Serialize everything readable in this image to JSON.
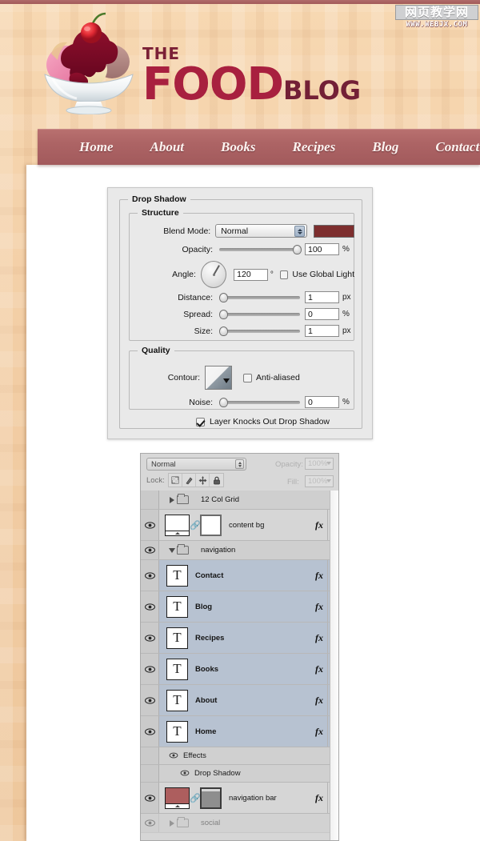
{
  "site": {
    "brand_the": "THE",
    "brand_food": "FOOD",
    "brand_blog": "BLOG",
    "logo_icon": "ice-cream-sundae-icon",
    "nav": [
      {
        "label": "Home"
      },
      {
        "label": "About"
      },
      {
        "label": "Books"
      },
      {
        "label": "Recipes"
      },
      {
        "label": "Blog"
      },
      {
        "label": "Contact"
      }
    ],
    "colors": {
      "nav_bar": "#ad6465",
      "food_red": "#a8203f",
      "dark_maroon": "#732036",
      "page_bg": "#f2cda4"
    }
  },
  "watermark": {
    "cn": "网页教学网",
    "url": "WWW.WEBJX.COM"
  },
  "dialog": {
    "title": "Drop Shadow",
    "structure": {
      "legend": "Structure",
      "blend_mode_label": "Blend Mode:",
      "blend_mode_value": "Normal",
      "color_swatch": "#7d2e2e",
      "opacity_label": "Opacity:",
      "opacity_value": "100",
      "opacity_unit": "%",
      "angle_label": "Angle:",
      "angle_value": "120",
      "angle_unit": "°",
      "use_global_light_label": "Use Global Light",
      "use_global_light_checked": false,
      "distance_label": "Distance:",
      "distance_value": "1",
      "distance_unit": "px",
      "spread_label": "Spread:",
      "spread_value": "0",
      "spread_unit": "%",
      "size_label": "Size:",
      "size_value": "1",
      "size_unit": "px"
    },
    "quality": {
      "legend": "Quality",
      "contour_label": "Contour:",
      "anti_aliased_label": "Anti-aliased",
      "anti_aliased_checked": false,
      "noise_label": "Noise:",
      "noise_value": "0",
      "noise_unit": "%"
    },
    "knockout_label": "Layer Knocks Out Drop Shadow",
    "knockout_checked": true
  },
  "layers_panel": {
    "blend_mode": "Normal",
    "opacity_label": "Opacity:",
    "opacity_value": "100%",
    "lock_label": "Lock:",
    "fill_label": "Fill:",
    "fill_value": "100%",
    "lock_icons": [
      "lock-transparency-icon",
      "lock-paint-icon",
      "lock-position-icon",
      "lock-all-icon"
    ],
    "rows": [
      {
        "kind": "group",
        "name": "12 Col Grid",
        "visible": false,
        "expanded": false,
        "selected": false,
        "fx": false
      },
      {
        "kind": "layer",
        "name": "content bg",
        "thumb": "image-mask",
        "thumb_color": "#ffffff",
        "visible": true,
        "selected": false,
        "fx": true,
        "chevron": "down"
      },
      {
        "kind": "group",
        "name": "navigation",
        "visible": true,
        "expanded": true,
        "selected": false,
        "fx": false
      },
      {
        "kind": "layer",
        "name": "Contact",
        "thumb": "text",
        "visible": true,
        "selected": true,
        "fx": true,
        "chevron": "down"
      },
      {
        "kind": "layer",
        "name": "Blog",
        "thumb": "text",
        "visible": true,
        "selected": true,
        "fx": true,
        "chevron": "down"
      },
      {
        "kind": "layer",
        "name": "Recipes",
        "thumb": "text",
        "visible": true,
        "selected": true,
        "fx": true,
        "chevron": "down"
      },
      {
        "kind": "layer",
        "name": "Books",
        "thumb": "text",
        "visible": true,
        "selected": true,
        "fx": true,
        "chevron": "down"
      },
      {
        "kind": "layer",
        "name": "About",
        "thumb": "text",
        "visible": true,
        "selected": true,
        "fx": true,
        "chevron": "down"
      },
      {
        "kind": "layer",
        "name": "Home",
        "thumb": "text",
        "visible": true,
        "selected": true,
        "fx": true,
        "chevron": "up"
      },
      {
        "kind": "effect",
        "name": "Effects",
        "indent": 1,
        "visible": true
      },
      {
        "kind": "effect",
        "name": "Drop Shadow",
        "indent": 2,
        "visible": true
      },
      {
        "kind": "layer",
        "name": "navigation bar",
        "thumb": "image-mask",
        "thumb_color": "#ad5e5e",
        "visible": true,
        "selected": false,
        "fx": true,
        "chevron": "down"
      },
      {
        "kind": "group",
        "name": "social",
        "visible": true,
        "expanded": false,
        "selected": false,
        "fx": false,
        "faded": true
      }
    ]
  }
}
